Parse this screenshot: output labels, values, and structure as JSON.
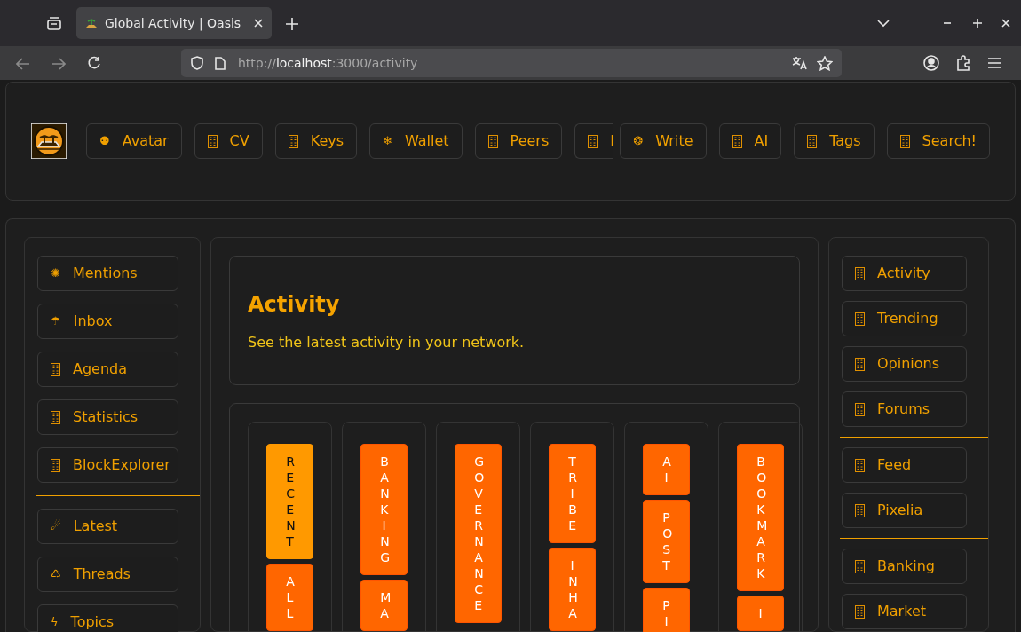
{
  "browser": {
    "tab": {
      "title": "Global Activity | Oasis",
      "selected": true
    },
    "url": {
      "scheme": "http://",
      "host": "localhost",
      "rest": ":3000/activity"
    },
    "forward_disabled": true
  },
  "nav": [
    {
      "label": "Avatar",
      "icon": "⚉"
    },
    {
      "label": "CV"
    },
    {
      "label": "Keys"
    },
    {
      "label": "Wallet",
      "icon": "❄"
    },
    {
      "label": "Peers"
    },
    {
      "label": "I",
      "cut": true
    },
    {
      "label": "Write",
      "icon": "❂"
    },
    {
      "label": "AI"
    },
    {
      "label": "Tags"
    },
    {
      "label": "Search!"
    }
  ],
  "left_menu": [
    [
      {
        "label": "Mentions",
        "icon": "✺"
      },
      {
        "label": "Inbox",
        "icon": "☂"
      },
      {
        "label": "Agenda"
      },
      {
        "label": "Statistics"
      },
      {
        "label": "BlockExplorer"
      }
    ],
    [
      {
        "label": "Latest",
        "icon": "☄"
      },
      {
        "label": "Threads",
        "icon": "♺"
      },
      {
        "label": "Topics",
        "icon": "ϟ"
      }
    ]
  ],
  "intro": {
    "title": "Activity",
    "text": "See the latest activity in your network."
  },
  "filters": [
    [
      {
        "label": "RECENT",
        "selected": true
      },
      {
        "label": "ALL",
        "selected": false
      }
    ],
    [
      {
        "label": "BANKING",
        "selected": false
      },
      {
        "label": "MA",
        "selected": false
      }
    ],
    [
      {
        "label": "GOVERNANCE",
        "selected": false
      }
    ],
    [
      {
        "label": "TRIBE",
        "selected": false
      },
      {
        "label": "INHA",
        "selected": false
      }
    ],
    [
      {
        "label": "AI",
        "selected": false
      },
      {
        "label": "POST",
        "selected": false
      },
      {
        "label": "PI",
        "selected": false
      }
    ],
    [
      {
        "label": "BOOKMARK",
        "selected": false
      },
      {
        "label": "I",
        "selected": false
      }
    ]
  ],
  "right_menu": [
    [
      {
        "label": "Activity"
      },
      {
        "label": "Trending"
      },
      {
        "label": "Opinions"
      },
      {
        "label": "Forums"
      }
    ],
    [
      {
        "label": "Feed"
      },
      {
        "label": "Pixelia"
      }
    ],
    [
      {
        "label": "Banking"
      },
      {
        "label": "Market"
      }
    ]
  ]
}
